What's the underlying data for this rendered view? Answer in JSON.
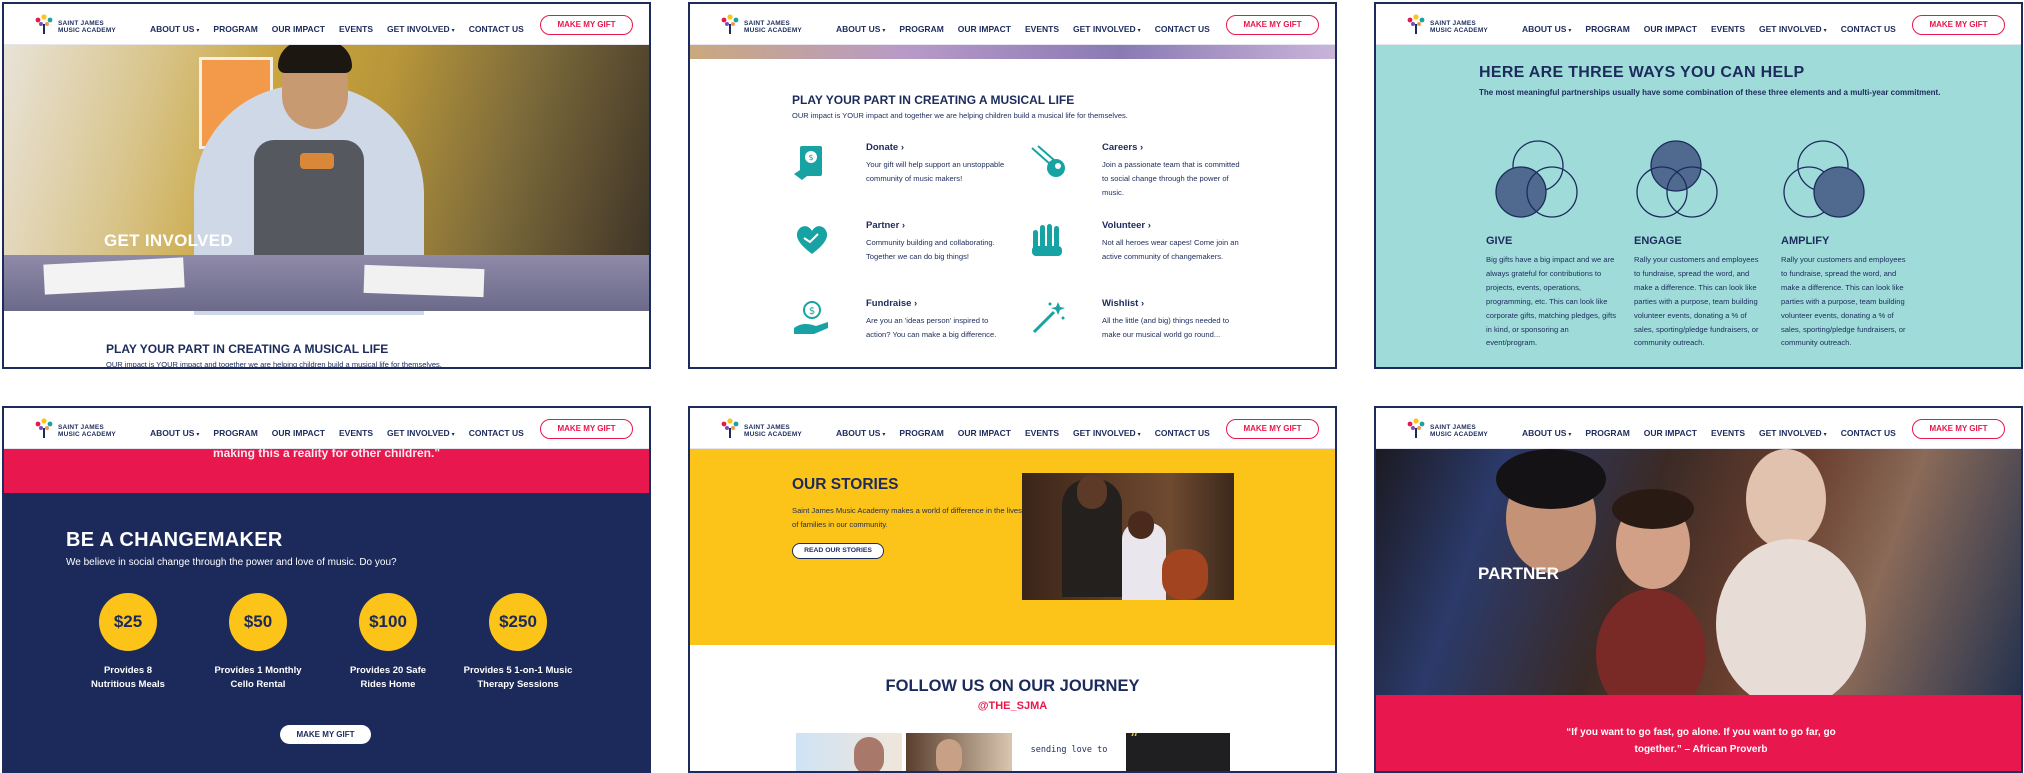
{
  "nav": {
    "logo_line1": "SAINT JAMES",
    "logo_line2": "MUSIC ACADEMY",
    "items": [
      {
        "label": "ABOUT US",
        "dropdown": true
      },
      {
        "label": "PROGRAM",
        "dropdown": false
      },
      {
        "label": "OUR IMPACT",
        "dropdown": false
      },
      {
        "label": "EVENTS",
        "dropdown": false
      },
      {
        "label": "GET INVOLVED",
        "dropdown": true
      },
      {
        "label": "CONTACT US",
        "dropdown": false
      }
    ],
    "cta": "MAKE MY GIFT",
    "caret": "▾"
  },
  "colors": {
    "navy": "#1b2a5a",
    "red": "#e8174e",
    "yellow": "#fcc419",
    "teal": "#9fdbd9",
    "icon_teal": "#17a3a3"
  },
  "panel1": {
    "hero_title": "GET INVOLVED",
    "heading": "PLAY YOUR PART IN CREATING A MUSICAL LIFE",
    "sub": "OUR impact is YOUR impact and together we are helping children build a musical life for themselves."
  },
  "panel2": {
    "heading": "PLAY YOUR PART IN CREATING A MUSICAL LIFE",
    "sub": "OUR impact is YOUR impact and together we are helping children build a musical life for themselves.",
    "ways": [
      {
        "title": "Donate ›",
        "desc": "Your gift will help support an unstoppable community of music makers!",
        "icon": "donate-icon"
      },
      {
        "title": "Careers ›",
        "desc": "Join a passionate team that is committed to social change through the power of music.",
        "icon": "careers-icon"
      },
      {
        "title": "Partner ›",
        "desc": "Community building and collaborating. Together we can do big things!",
        "icon": "partner-icon"
      },
      {
        "title": "Volunteer ›",
        "desc": "Not all heroes wear capes! Come join an active community of changemakers.",
        "icon": "volunteer-icon"
      },
      {
        "title": "Fundraise ›",
        "desc": "Are you an 'ideas person' inspired to action? You can make a big difference.",
        "icon": "fundraise-icon"
      },
      {
        "title": "Wishlist ›",
        "desc": "All the little (and big) things needed to make our musical world go round...",
        "icon": "wishlist-icon"
      }
    ]
  },
  "panel3": {
    "heading": "HERE ARE THREE WAYS YOU CAN HELP",
    "sub": "The most meaningful partnerships usually have some combination of these three elements and a multi-year commitment.",
    "items": [
      {
        "title": "GIVE",
        "desc": "Big gifts have a big impact and we are always grateful for contributions to projects, events, operations, programming, etc. This can look like corporate gifts, matching pledges, gifts in kind, or sponsoring an event/program."
      },
      {
        "title": "ENGAGE",
        "desc": "Rally your customers and employees to fundraise, spread the word, and make a difference. This can look like parties with a purpose, team building volunteer events, donating a % of sales, sporting/pledge fundraisers, or community outreach."
      },
      {
        "title": "AMPLIFY",
        "desc": "Rally your customers and employees to fundraise, spread the word, and make a difference. This can look like parties with a purpose, team building volunteer events, donating a % of sales, sporting/pledge fundraisers, or community outreach."
      }
    ]
  },
  "panel4": {
    "quote_tail": "making this a reality for other children.\"",
    "title": "BE A CHANGEMAKER",
    "sub": "We believe in social change through the power and love of music. Do you?",
    "amounts": [
      {
        "amount": "$25",
        "line1": "Provides 8",
        "line2": "Nutritious Meals"
      },
      {
        "amount": "$50",
        "line1": "Provides 1 Monthly",
        "line2": "Cello Rental"
      },
      {
        "amount": "$100",
        "line1": "Provides 20 Safe",
        "line2": "Rides Home"
      },
      {
        "amount": "$250",
        "line1": "Provides 5 1-on-1 Music",
        "line2": "Therapy Sessions"
      }
    ],
    "cta": "MAKE MY GIFT"
  },
  "panel5": {
    "title": "OUR STORIES",
    "sub": "Saint James Music Academy makes a world of difference in the lives of families in our community.",
    "cta": "READ OUR STORIES",
    "follow": "FOLLOW US ON OUR JOURNEY",
    "handle": "@THE_SJMA",
    "ig_caption": "sending love to",
    "ig_quote": "“"
  },
  "panel6": {
    "hero_title": "PARTNER",
    "quote_line1": "“If you want to go fast, go alone.  If you want to go far, go",
    "quote_line2": "together.” – African Proverb"
  }
}
